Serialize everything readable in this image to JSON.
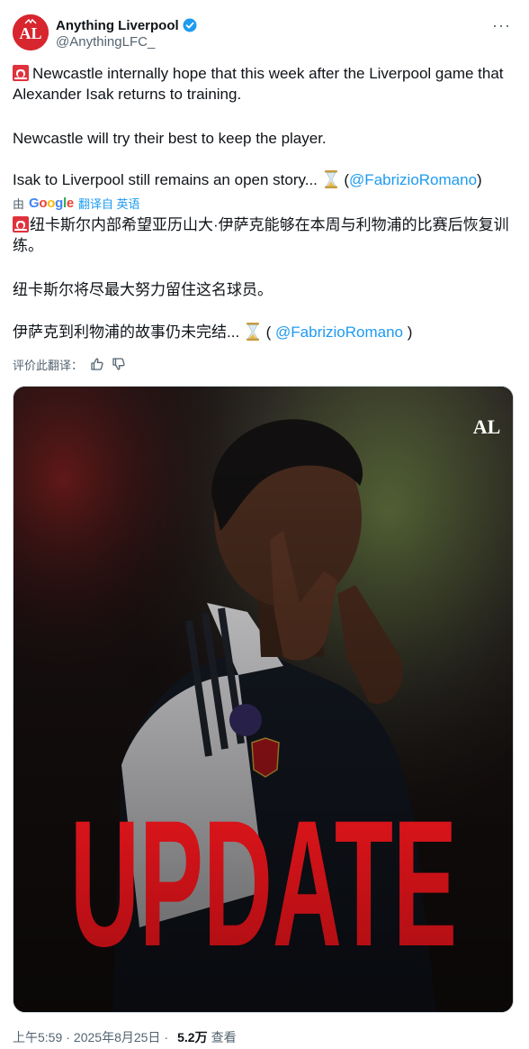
{
  "author": {
    "display_name": "Anything Liverpool",
    "handle": "@AnythingLFC_",
    "avatar_text": "AL",
    "verified": true
  },
  "tweet": {
    "line1": "Newcastle internally hope that this week after the Liverpool game that Alexander Isak returns to training.",
    "line2": "Newcastle will try their best to keep the player.",
    "line3_text": "Isak to Liverpool still remains an open story...",
    "line3_mention": "@FabrizioRomano",
    "open_paren": "(",
    "close_paren": ")"
  },
  "translation": {
    "by_prefix": "由",
    "google_letters": [
      "G",
      "o",
      "o",
      "g",
      "l",
      "e"
    ],
    "translated_from": "翻译自 英语",
    "line1": "纽卡斯尔内部希望亚历山大·伊萨克能够在本周与利物浦的比赛后恢复训练。",
    "line2": "纽卡斯尔将尽最大努力留住这名球员。",
    "line3_text": "伊萨克到利物浦的故事仍未完结...",
    "line3_mention": "@FabrizioRomano",
    "open_paren": " ( ",
    "close_paren": " )"
  },
  "rate_translation_label": "评价此翻译：",
  "media": {
    "overlay_text": "UPDATE",
    "watermark": "AL"
  },
  "meta": {
    "time": "上午5:59",
    "date": "2025年8月25日",
    "views_count": "5.2万",
    "views_label": "查看",
    "separator": "·"
  },
  "colors": {
    "accent": "#1d9bf0",
    "brand_red": "#d7262e",
    "text_primary": "#0f1419",
    "text_secondary": "#536471"
  }
}
